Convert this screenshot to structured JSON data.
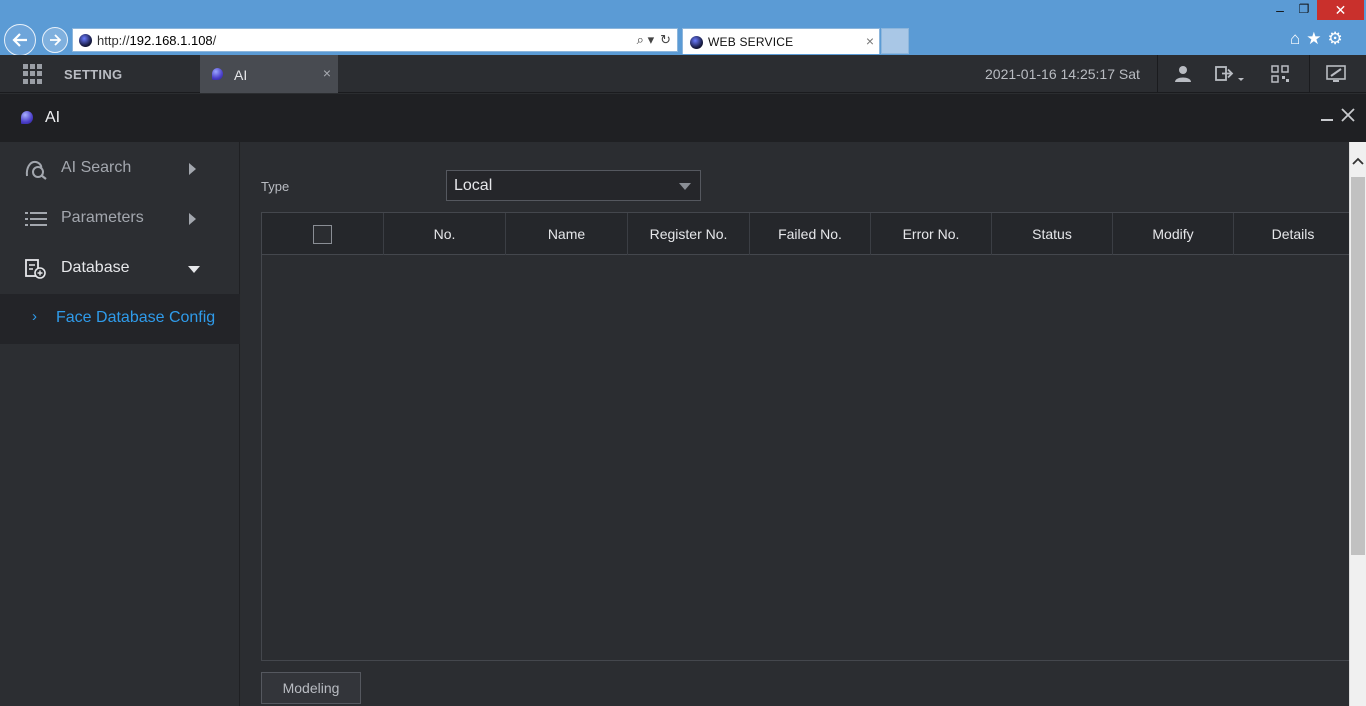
{
  "browser": {
    "url_prefix": "http://",
    "url_host": "192.168.1.108",
    "url_suffix": "/",
    "tab_title": "WEB SERVICE",
    "tab_close": "×",
    "win_min": "–",
    "win_max": "❐",
    "win_close": "✕",
    "addr_tools": [
      "⌕ ▾",
      "↻"
    ],
    "toolbar_icons": [
      "⌂",
      "★",
      "⚙"
    ]
  },
  "topbar": {
    "setting_label": "SETTING",
    "app_tab_label": "AI",
    "app_tab_close": "×",
    "datetime": "2021-01-16 14:25:17 Sat"
  },
  "window": {
    "title": "AI"
  },
  "sidebar": {
    "items": [
      {
        "label": "AI Search",
        "icon": "ai-search-icon",
        "expanded": false
      },
      {
        "label": "Parameters",
        "icon": "list-icon",
        "expanded": false
      },
      {
        "label": "Database",
        "icon": "database-icon",
        "expanded": true
      }
    ],
    "sub_item": {
      "chevron": "›",
      "label": "Face Database Config"
    }
  },
  "main": {
    "type_label": "Type",
    "type_value": "Local",
    "columns": [
      "No.",
      "Name",
      "Register No.",
      "Failed No.",
      "Error No.",
      "Status",
      "Modify",
      "Details"
    ],
    "rows": [],
    "modeling_label": "Modeling"
  },
  "colors": {
    "accent_blue": "#2f9bea",
    "browser_blue": "#5b9bd5",
    "close_red": "#c9302c"
  }
}
